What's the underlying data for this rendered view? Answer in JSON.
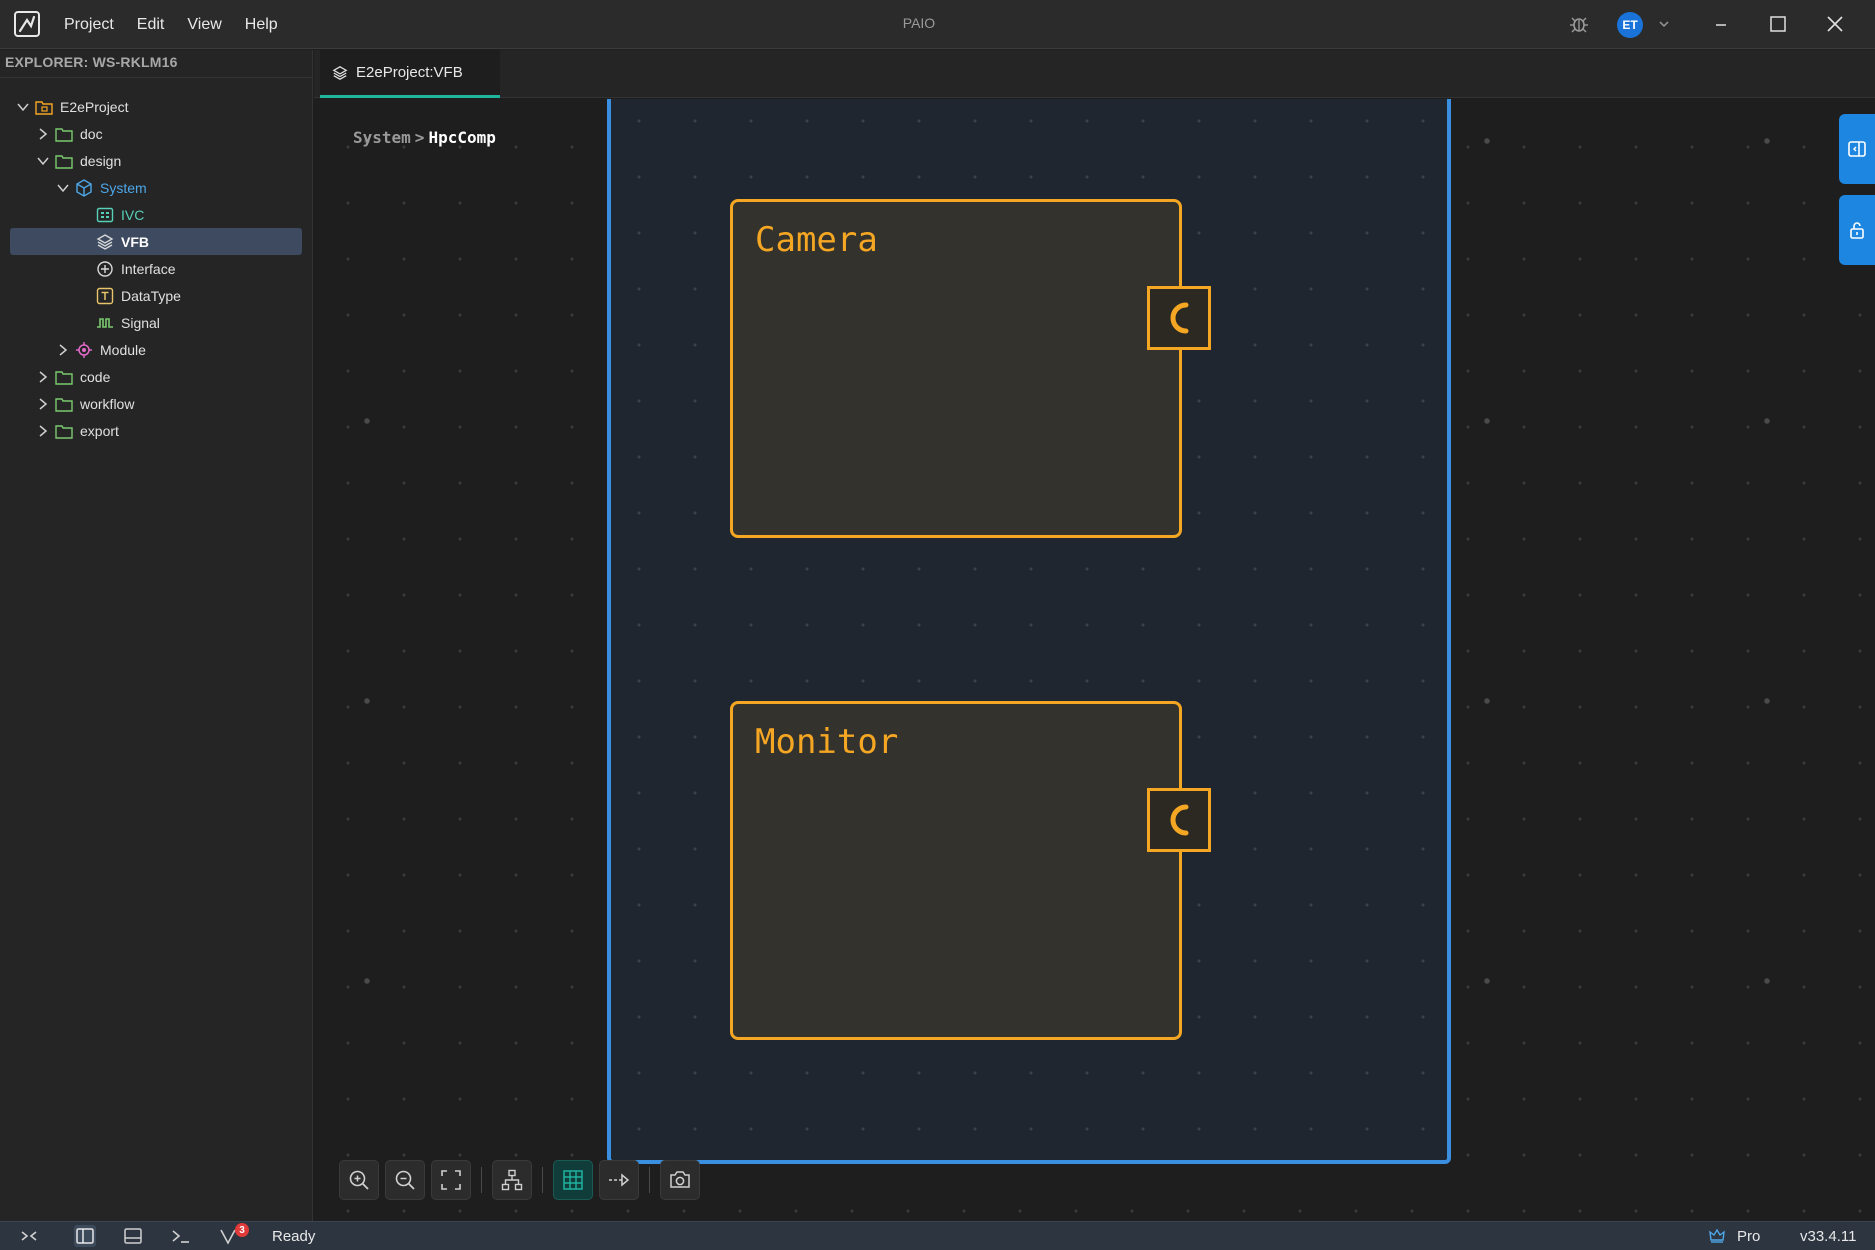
{
  "app": {
    "title": "PAIO",
    "menu": [
      "Project",
      "Edit",
      "View",
      "Help"
    ],
    "user_initials": "ET"
  },
  "explorer": {
    "title": "EXPLORER: WS-RKLM16",
    "tree": [
      {
        "label": "E2eProject",
        "icon": "project-folder-icon",
        "expanded": true
      },
      {
        "label": "doc",
        "icon": "folder-icon",
        "expanded": false
      },
      {
        "label": "design",
        "icon": "folder-icon",
        "expanded": true
      },
      {
        "label": "System",
        "icon": "cube-icon",
        "expanded": true
      },
      {
        "label": "IVC",
        "icon": "grid-icon"
      },
      {
        "label": "VFB",
        "icon": "layers-icon",
        "selected": true
      },
      {
        "label": "Interface",
        "icon": "interface-icon"
      },
      {
        "label": "DataType",
        "icon": "type-icon"
      },
      {
        "label": "Signal",
        "icon": "signal-icon"
      },
      {
        "label": "Module",
        "icon": "module-icon",
        "expanded": false
      },
      {
        "label": "code",
        "icon": "folder-icon",
        "expanded": false
      },
      {
        "label": "workflow",
        "icon": "folder-icon",
        "expanded": false
      },
      {
        "label": "export",
        "icon": "folder-icon",
        "expanded": false
      }
    ]
  },
  "tabs": [
    {
      "label": "E2eProject:VFB",
      "icon": "layers-icon",
      "active": true
    }
  ],
  "canvas": {
    "breadcrumb": {
      "parent": "System",
      "separator": ">",
      "current": "HpcComp"
    },
    "components": [
      {
        "name": "Camera",
        "port": "C"
      },
      {
        "name": "Monitor",
        "port": "C"
      }
    ]
  },
  "toolbar": {
    "buttons": [
      "zoom-in-icon",
      "zoom-out-icon",
      "fit-screen-icon",
      "auto-layout-icon",
      "grid-icon",
      "connection-icon",
      "screenshot-icon"
    ],
    "active": "grid-icon"
  },
  "statusbar": {
    "status": "Ready",
    "vcs_badge": "3",
    "plan": "Pro",
    "version": "v33.4.11"
  },
  "colors": {
    "accent": "#1d86e0",
    "component": "#f5a623",
    "frame": "#3b8fe0",
    "tab_indicator": "#1fb4a0"
  }
}
